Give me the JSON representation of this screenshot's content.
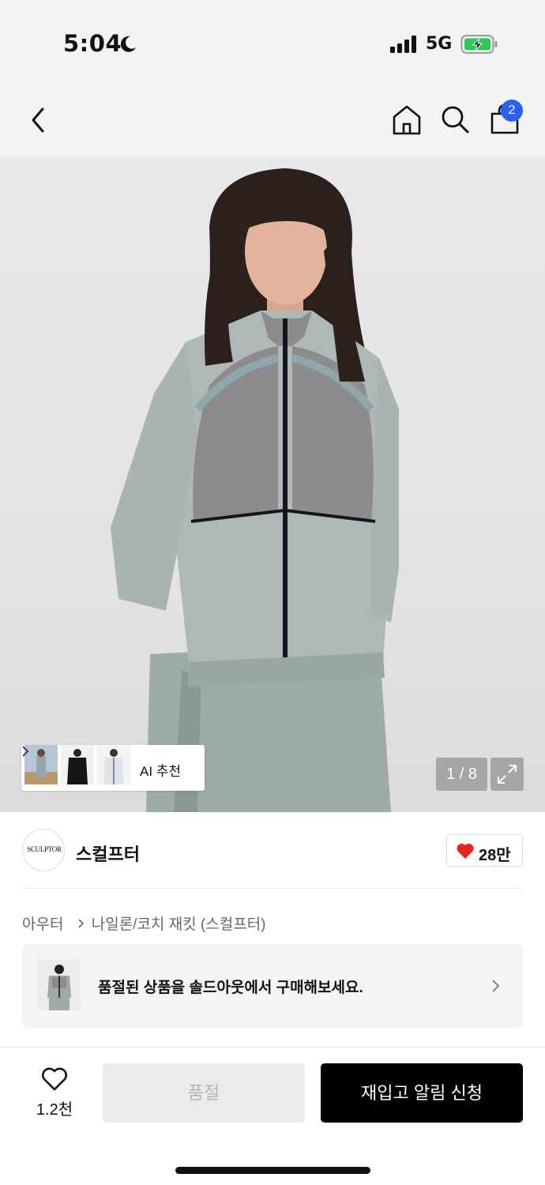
{
  "status_bar": {
    "time": "5:04",
    "network": "5G",
    "icons": [
      "moon-icon",
      "signal-icon",
      "battery-charging-icon"
    ]
  },
  "nav": {
    "icons": [
      "back-icon",
      "home-icon",
      "search-icon",
      "shopping-bag-icon"
    ],
    "cart_count": "2"
  },
  "gallery": {
    "ai_recommend_label": "AI 추천",
    "counter": "1 / 8",
    "expand_icon": "expand-icon"
  },
  "brand": {
    "logo_text": "SCULPTOR",
    "name": "스컬프터",
    "likes": "28만",
    "like_color": "#e8221f"
  },
  "breadcrumb": {
    "category": "아우터",
    "subcategory": "나일론/코치 재킷 (스컬프터)"
  },
  "soldout_banner": {
    "text": "품절된 상품을 솔드아웃에서 구매해보세요."
  },
  "bottom_bar": {
    "wish_count": "1.2천",
    "soldout_label": "품절",
    "restock_label": "재입고 알림 신청"
  },
  "colors": {
    "badge": "#2b5ff2",
    "primary_button": "#000000",
    "disabled_button": "#ebebeb"
  }
}
